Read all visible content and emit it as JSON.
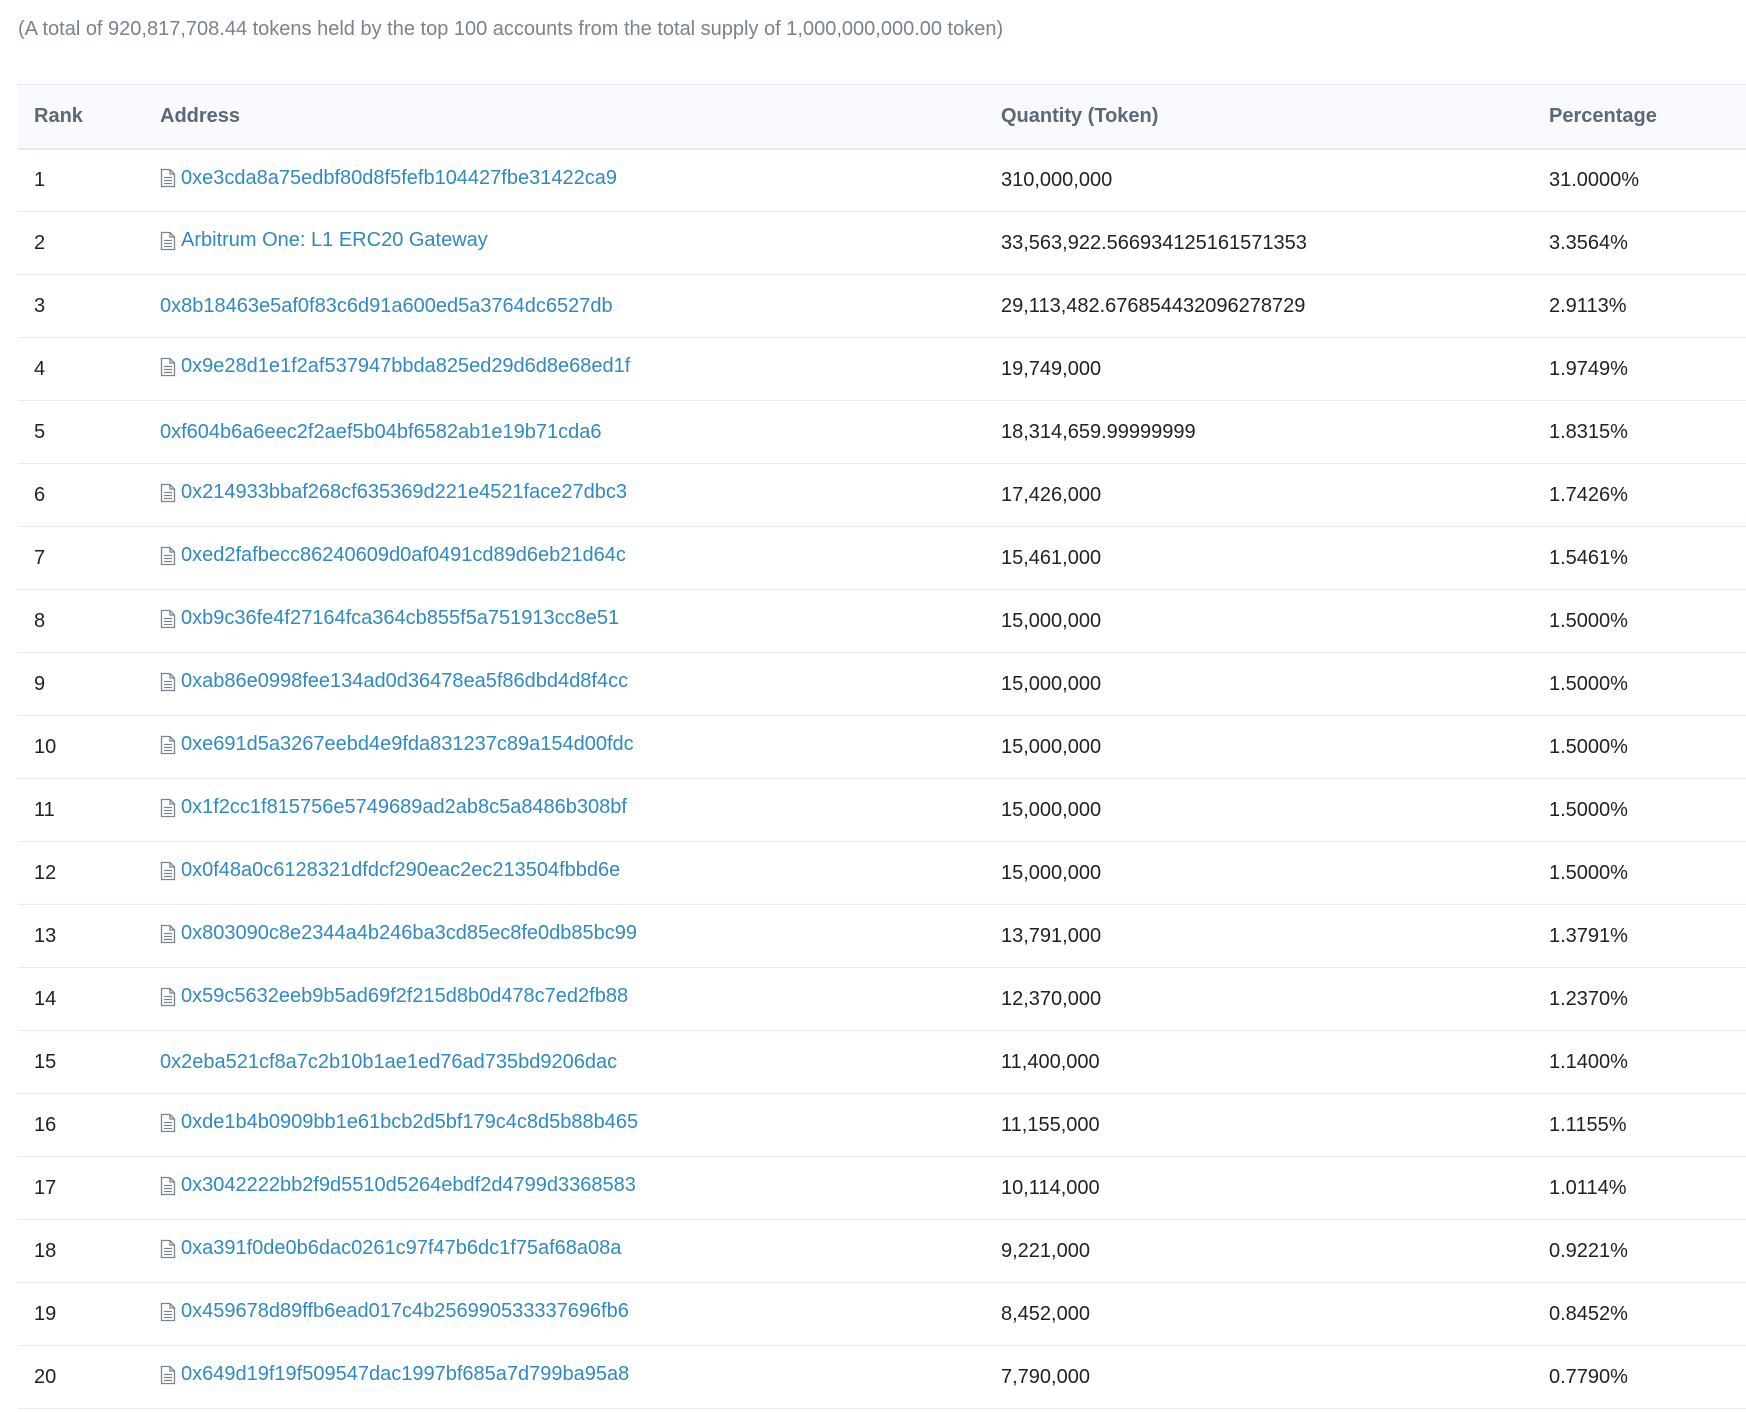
{
  "summary": "(A total of 920,817,708.44 tokens held by the top 100 accounts from the total supply of 1,000,000,000.00 token)",
  "columns": {
    "rank": "Rank",
    "address": "Address",
    "quantity": "Quantity (Token)",
    "percentage": "Percentage"
  },
  "colors": {
    "link": "#2e89c4",
    "muted": "#77838f",
    "header_bg": "#f8fafd",
    "border": "#e7eaf3"
  },
  "rows": [
    {
      "rank": "1",
      "contract": true,
      "address": "0xe3cda8a75edbf80d8f5fefb104427fbe31422ca9",
      "quantity": "310,000,000",
      "percentage": "31.0000%"
    },
    {
      "rank": "2",
      "contract": true,
      "address": "Arbitrum One: L1 ERC20 Gateway",
      "quantity": "33,563,922.566934125161571353",
      "percentage": "3.3564%"
    },
    {
      "rank": "3",
      "contract": false,
      "address": "0x8b18463e5af0f83c6d91a600ed5a3764dc6527db",
      "quantity": "29,113,482.676854432096278729",
      "percentage": "2.9113%"
    },
    {
      "rank": "4",
      "contract": true,
      "address": "0x9e28d1e1f2af537947bbda825ed29d6d8e68ed1f",
      "quantity": "19,749,000",
      "percentage": "1.9749%"
    },
    {
      "rank": "5",
      "contract": false,
      "address": "0xf604b6a6eec2f2aef5b04bf6582ab1e19b71cda6",
      "quantity": "18,314,659.99999999",
      "percentage": "1.8315%"
    },
    {
      "rank": "6",
      "contract": true,
      "address": "0x214933bbaf268cf635369d221e4521face27dbc3",
      "quantity": "17,426,000",
      "percentage": "1.7426%"
    },
    {
      "rank": "7",
      "contract": true,
      "address": "0xed2fafbecc86240609d0af0491cd89d6eb21d64c",
      "quantity": "15,461,000",
      "percentage": "1.5461%"
    },
    {
      "rank": "8",
      "contract": true,
      "address": "0xb9c36fe4f27164fca364cb855f5a751913cc8e51",
      "quantity": "15,000,000",
      "percentage": "1.5000%"
    },
    {
      "rank": "9",
      "contract": true,
      "address": "0xab86e0998fee134ad0d36478ea5f86dbd4d8f4cc",
      "quantity": "15,000,000",
      "percentage": "1.5000%"
    },
    {
      "rank": "10",
      "contract": true,
      "address": "0xe691d5a3267eebd4e9fda831237c89a154d00fdc",
      "quantity": "15,000,000",
      "percentage": "1.5000%"
    },
    {
      "rank": "11",
      "contract": true,
      "address": "0x1f2cc1f815756e5749689ad2ab8c5a8486b308bf",
      "quantity": "15,000,000",
      "percentage": "1.5000%"
    },
    {
      "rank": "12",
      "contract": true,
      "address": "0x0f48a0c6128321dfdcf290eac2ec213504fbbd6e",
      "quantity": "15,000,000",
      "percentage": "1.5000%"
    },
    {
      "rank": "13",
      "contract": true,
      "address": "0x803090c8e2344a4b246ba3cd85ec8fe0db85bc99",
      "quantity": "13,791,000",
      "percentage": "1.3791%"
    },
    {
      "rank": "14",
      "contract": true,
      "address": "0x59c5632eeb9b5ad69f2f215d8b0d478c7ed2fb88",
      "quantity": "12,370,000",
      "percentage": "1.2370%"
    },
    {
      "rank": "15",
      "contract": false,
      "address": "0x2eba521cf8a7c2b10b1ae1ed76ad735bd9206dac",
      "quantity": "11,400,000",
      "percentage": "1.1400%"
    },
    {
      "rank": "16",
      "contract": true,
      "address": "0xde1b4b0909bb1e61bcb2d5bf179c4c8d5b88b465",
      "quantity": "11,155,000",
      "percentage": "1.1155%"
    },
    {
      "rank": "17",
      "contract": true,
      "address": "0x3042222bb2f9d5510d5264ebdf2d4799d3368583",
      "quantity": "10,114,000",
      "percentage": "1.0114%"
    },
    {
      "rank": "18",
      "contract": true,
      "address": "0xa391f0de0b6dac0261c97f47b6dc1f75af68a08a",
      "quantity": "9,221,000",
      "percentage": "0.9221%"
    },
    {
      "rank": "19",
      "contract": true,
      "address": "0x459678d89ffb6ead017c4b256990533337696fb6",
      "quantity": "8,452,000",
      "percentage": "0.8452%"
    },
    {
      "rank": "20",
      "contract": true,
      "address": "0x649d19f19f509547dac1997bf685a7d799ba95a8",
      "quantity": "7,790,000",
      "percentage": "0.7790%"
    }
  ]
}
